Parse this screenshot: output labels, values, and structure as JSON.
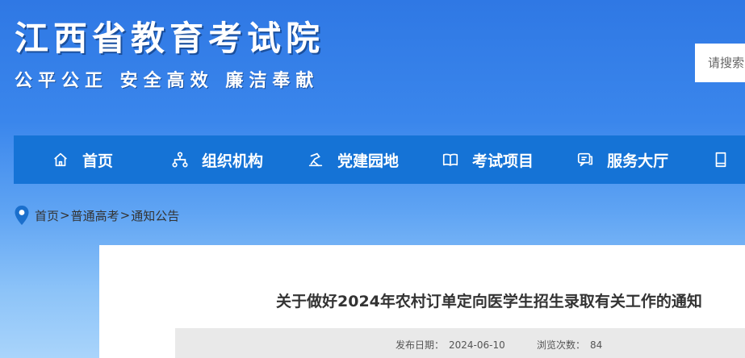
{
  "header": {
    "title": "江西省教育考试院",
    "slogan": "公平公正 安全高效 廉洁奉献",
    "search_placeholder": "请搜索"
  },
  "nav": {
    "items": [
      {
        "label": "首页",
        "icon": "home-icon"
      },
      {
        "label": "组织机构",
        "icon": "org-chart-icon"
      },
      {
        "label": "党建园地",
        "icon": "party-icon"
      },
      {
        "label": "考试项目",
        "icon": "book-icon"
      },
      {
        "label": "服务大厅",
        "icon": "service-icon"
      }
    ]
  },
  "breadcrumb": {
    "items": [
      "首页",
      "普通高考",
      "通知公告"
    ],
    "separator": ">"
  },
  "article": {
    "title": "关于做好2024年农村订单定向医学生招生录取有关工作的通知",
    "date_label": "发布日期：",
    "date": "2024-06-10",
    "views_label": "浏览次数：",
    "views": "84"
  },
  "colors": {
    "nav_bg": "#1573d6",
    "header_bg": "#2f78e4",
    "meta_bg": "#e9e9e9"
  }
}
